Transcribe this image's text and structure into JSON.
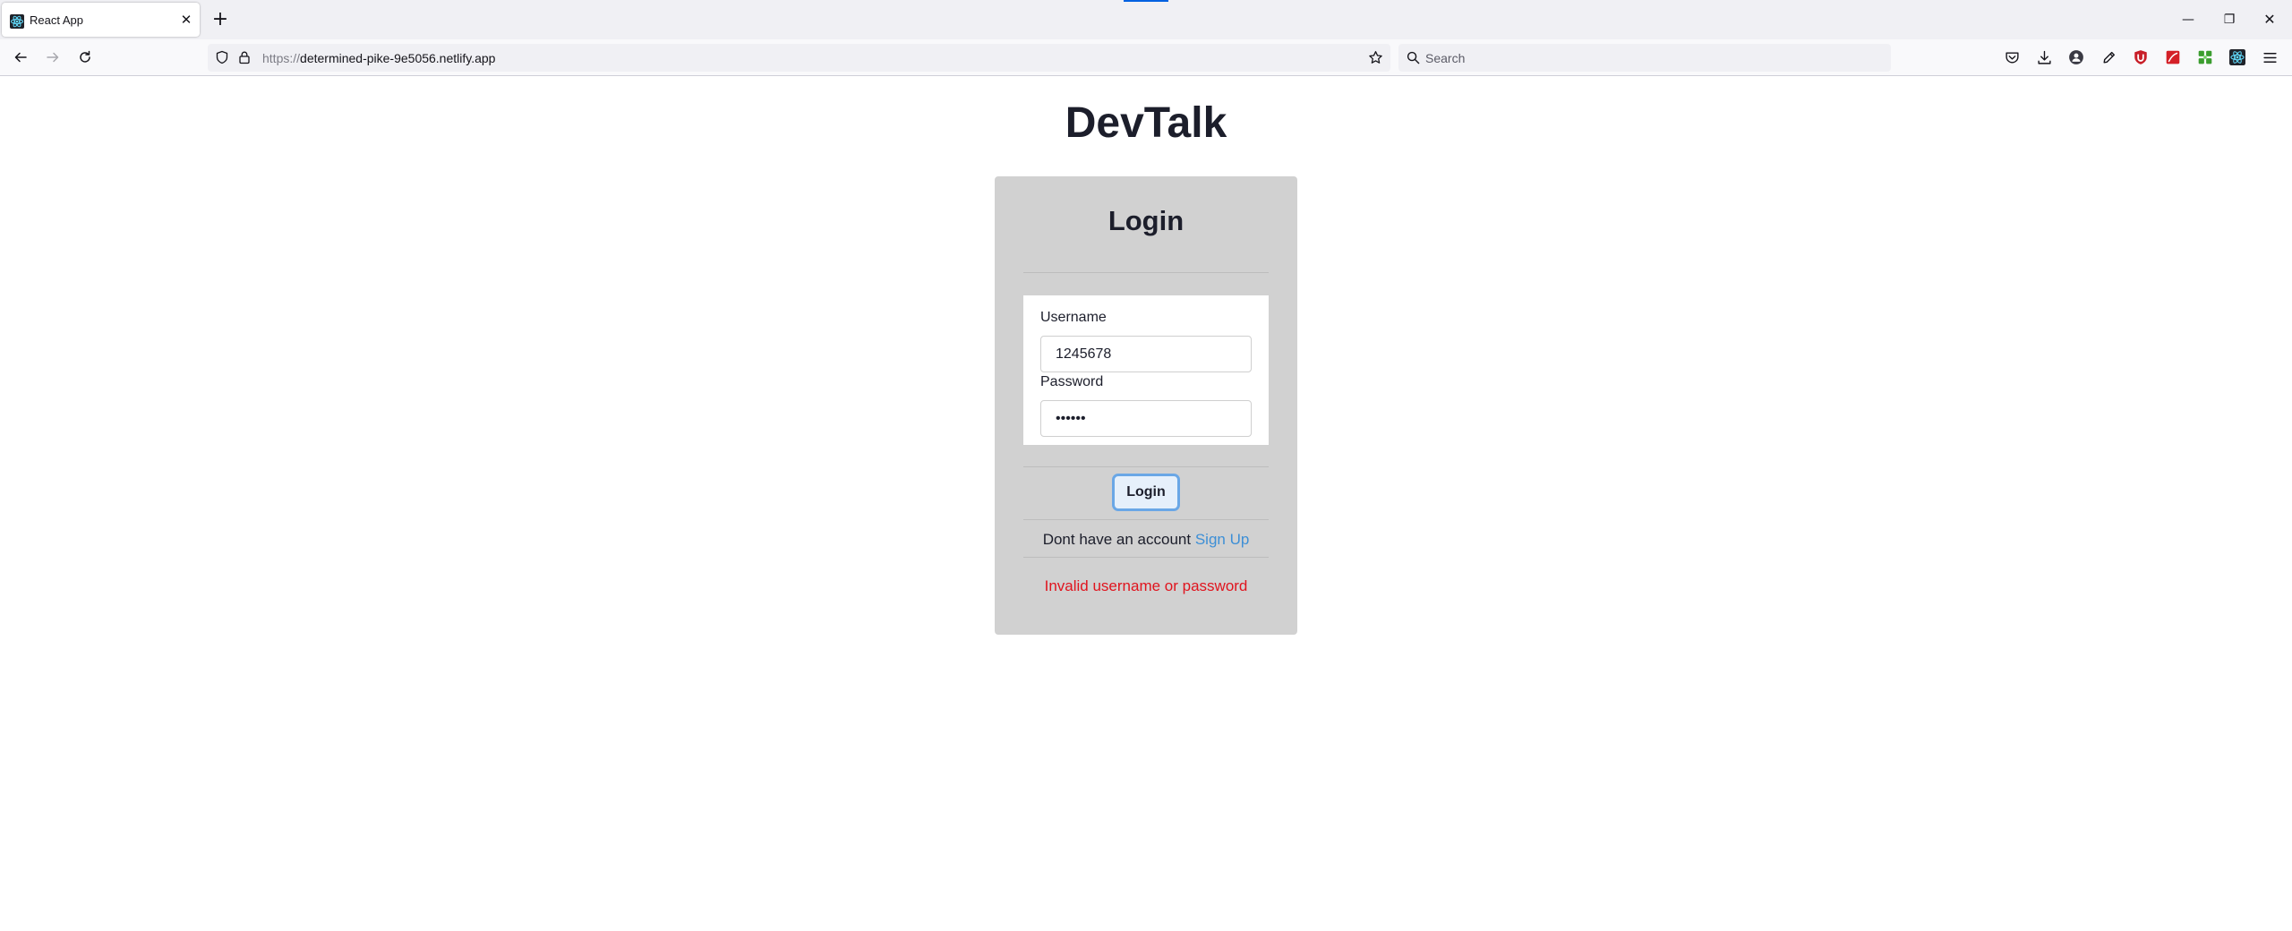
{
  "browser": {
    "tab": {
      "title": "React App",
      "close_glyph": "✕"
    },
    "new_tab_glyph": "+",
    "window": {
      "minimize": "—",
      "restore": "❐",
      "close": "✕"
    },
    "url": {
      "scheme": "https://",
      "host": "determined-pike-9e5056.netlify.app"
    },
    "search": {
      "placeholder": "Search"
    },
    "toolbar_icons": [
      "pocket-icon",
      "downloads-icon",
      "account-icon",
      "eyedropper-icon",
      "ublock-icon",
      "pdf-icon",
      "extension-puzzle-icon",
      "react-devtools-icon",
      "menu-icon"
    ]
  },
  "page": {
    "app_title": "DevTalk",
    "login_card": {
      "title": "Login",
      "username": {
        "label": "Username",
        "value": "1245678"
      },
      "password": {
        "label": "Password",
        "value": "••••••"
      },
      "submit_label": "Login",
      "signup_prompt": "Dont have an account",
      "signup_link": "Sign Up",
      "error_message": "Invalid username or password"
    }
  },
  "colors": {
    "card_bg": "#d1d1d1",
    "link": "#3d8fd6",
    "error": "#e0141e",
    "heading": "#1c1e2b"
  }
}
